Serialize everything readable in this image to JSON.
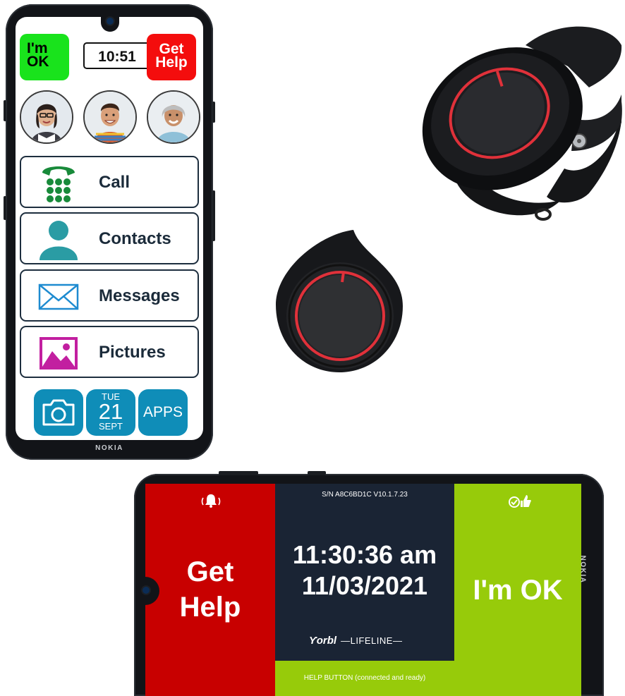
{
  "portrait_phone": {
    "brand": "NOKIA",
    "ok_button": "I'm\nOK",
    "clock": "10:51",
    "help_button": "Get\nHelp",
    "contacts": [
      {
        "icon": "woman-with-glasses-avatar-icon"
      },
      {
        "icon": "young-man-avatar-icon"
      },
      {
        "icon": "older-woman-avatar-icon"
      }
    ],
    "menu": [
      {
        "label": "Call",
        "icon": "phone-keypad-icon",
        "color": "#188a3a"
      },
      {
        "label": "Contacts",
        "icon": "person-icon",
        "color": "#2a9ca4"
      },
      {
        "label": "Messages",
        "icon": "envelope-icon",
        "color": "#1e8bd0"
      },
      {
        "label": "Pictures",
        "icon": "picture-icon",
        "color": "#c21fa0"
      }
    ],
    "bottom": {
      "camera_icon": "camera-icon",
      "calendar": {
        "dow": "TUE",
        "day": "21",
        "month": "SEPT"
      },
      "apps_label": "APPS"
    },
    "colors": {
      "ok": "#19e31c",
      "help": "#f40d0d",
      "tile": "#0f8db8"
    }
  },
  "landscape_phone": {
    "brand": "NOKIA",
    "help_icon": "alarm-bell-icon",
    "help_label": "Get\nHelp",
    "serial": "S/N A8C6BD1C V10.1.7.23",
    "time": "11:30:36 am",
    "date": "11/03/2021",
    "logo_brand": "orbl",
    "logo_sub": "—LIFELINE—",
    "status": "HELP BUTTON (connected and ready)",
    "ok_icon": "thumbs-up-check-icon",
    "ok_label": "I'm OK",
    "colors": {
      "help": "#c80000",
      "middle": "#1a2434",
      "ok": "#97cb0a"
    }
  }
}
